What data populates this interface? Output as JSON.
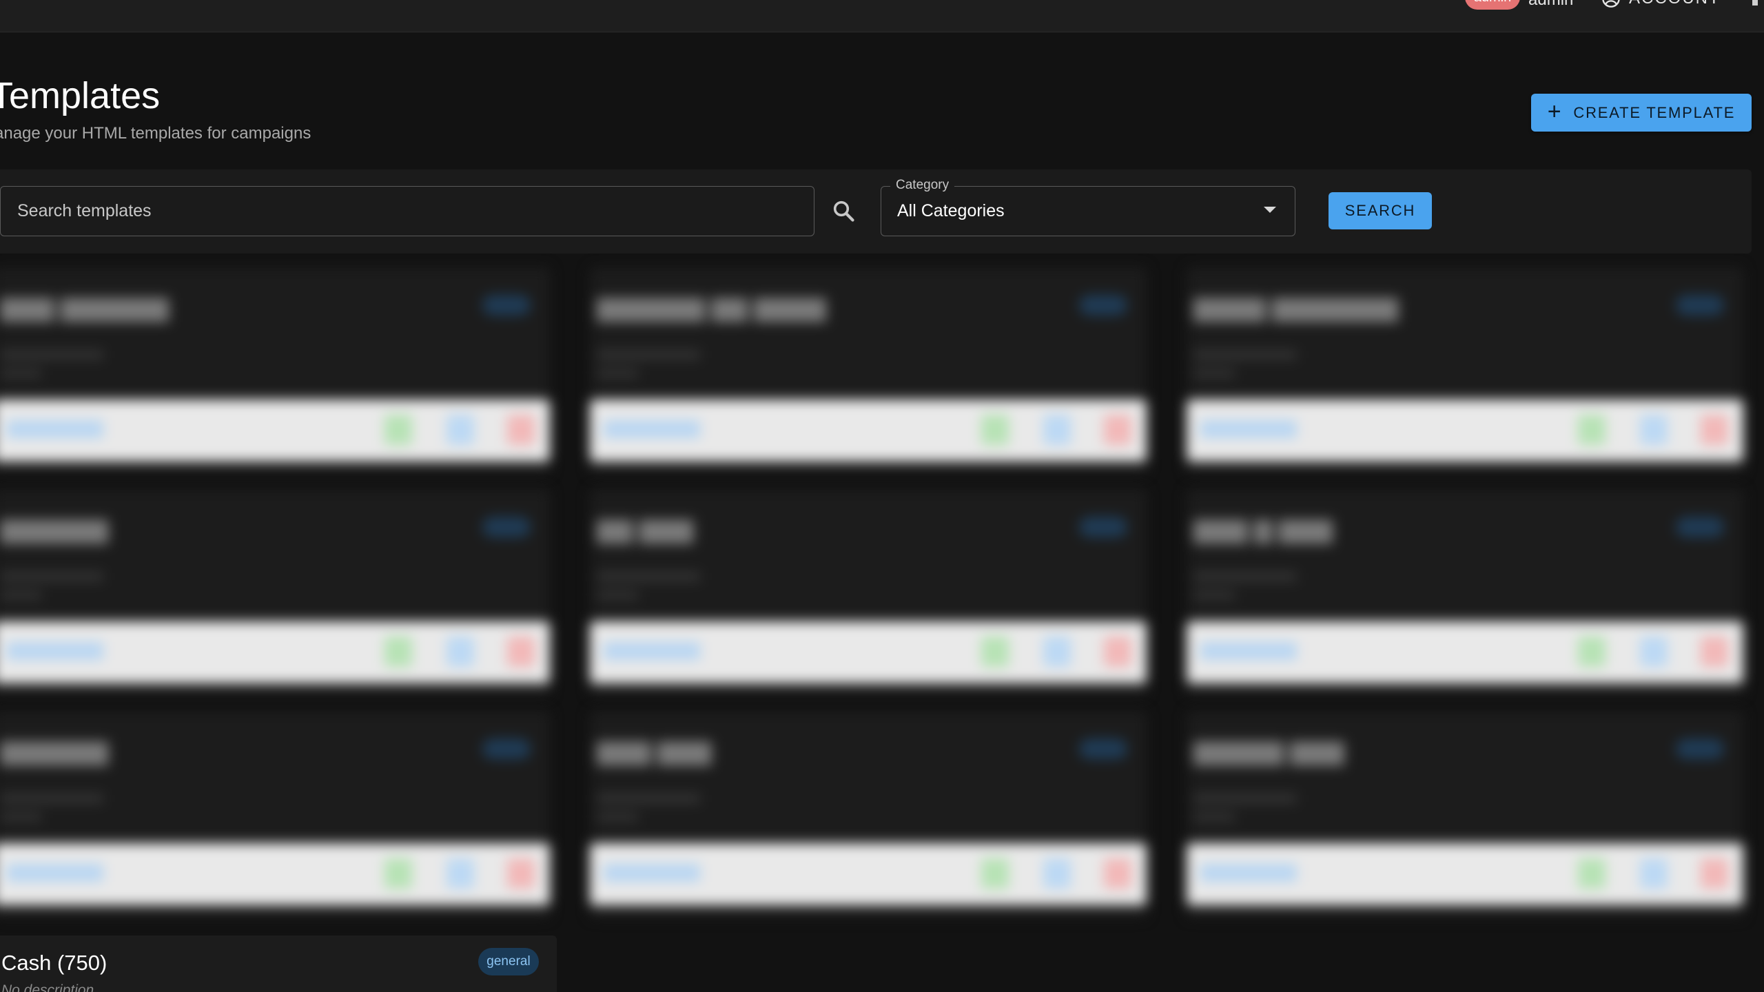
{
  "topbar": {
    "role_badge": "admin",
    "username": "admin",
    "account_label": "ACCOUNT"
  },
  "header": {
    "title": "Templates",
    "subtitle": "anage your HTML templates for campaigns",
    "create_button": "CREATE TEMPLATE"
  },
  "filters": {
    "search_placeholder": "Search templates",
    "category_label": "Category",
    "category_value": "All Categories",
    "search_button": "SEARCH"
  },
  "visible_card": {
    "title": "Cash (750)",
    "category": "general",
    "description": "No description"
  },
  "colors": {
    "accent": "#4aa3ee",
    "background": "#121212",
    "surface": "#1c1c1c",
    "role_badge": "#e57373"
  },
  "icons": {
    "account": "account-circle-icon",
    "search": "search-icon",
    "add": "plus-icon",
    "dropdown": "caret-down-icon"
  }
}
